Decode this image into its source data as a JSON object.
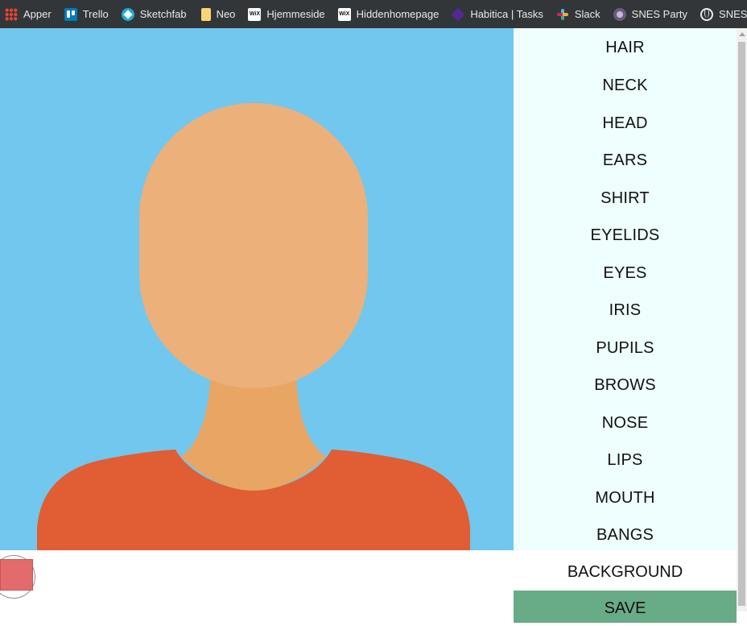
{
  "bookmarks": [
    {
      "label": "Apper",
      "icon": "apps-grid-icon"
    },
    {
      "label": "Trello",
      "icon": "trello-icon"
    },
    {
      "label": "Sketchfab",
      "icon": "sketchfab-icon"
    },
    {
      "label": "Neo",
      "icon": "bookmark-folder-icon"
    },
    {
      "label": "Hjemmeside",
      "icon": "wix-icon"
    },
    {
      "label": "Hiddenhomepage",
      "icon": "wix-icon"
    },
    {
      "label": "Habitica | Tasks",
      "icon": "habitica-icon"
    },
    {
      "label": "Slack",
      "icon": "slack-icon"
    },
    {
      "label": "SNES Party",
      "icon": "snes-icon"
    },
    {
      "label": "SNES Party_sav",
      "icon": "globe-icon"
    }
  ],
  "wix_icon_text": "WiX",
  "avatar": {
    "background_color": "#71c7ee",
    "skin_color": "#ecb07a",
    "neck_color": "#e9a564",
    "shirt_color": "#e15d33"
  },
  "menu": {
    "items": [
      "HAIR",
      "NECK",
      "HEAD",
      "EARS",
      "SHIRT",
      "EYELIDS",
      "EYES",
      "IRIS",
      "PUPILS",
      "BROWS",
      "NOSE",
      "LIPS",
      "MOUTH",
      "BANGS"
    ],
    "background_label": "BACKGROUND",
    "save_label": "SAVE"
  },
  "color_picker": {
    "selected_color": "#e36b6b"
  },
  "colors": {
    "menu_background": "#eefffd",
    "save_button": "#68ab87",
    "bookmarks_bar": "#323639"
  }
}
